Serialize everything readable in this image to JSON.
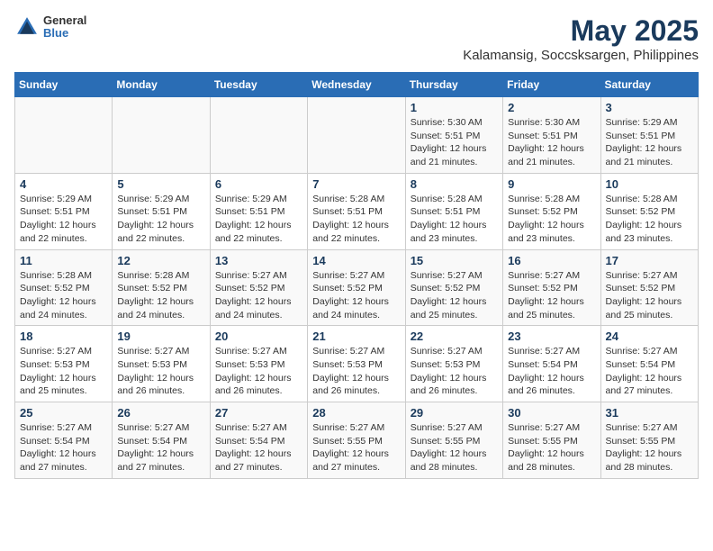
{
  "header": {
    "logo_line1": "General",
    "logo_line2": "Blue",
    "title": "May 2025",
    "subtitle": "Kalamansig, Soccsksargen, Philippines"
  },
  "weekdays": [
    "Sunday",
    "Monday",
    "Tuesday",
    "Wednesday",
    "Thursday",
    "Friday",
    "Saturday"
  ],
  "weeks": [
    [
      {
        "day": "",
        "info": ""
      },
      {
        "day": "",
        "info": ""
      },
      {
        "day": "",
        "info": ""
      },
      {
        "day": "",
        "info": ""
      },
      {
        "day": "1",
        "info": "Sunrise: 5:30 AM\nSunset: 5:51 PM\nDaylight: 12 hours\nand 21 minutes."
      },
      {
        "day": "2",
        "info": "Sunrise: 5:30 AM\nSunset: 5:51 PM\nDaylight: 12 hours\nand 21 minutes."
      },
      {
        "day": "3",
        "info": "Sunrise: 5:29 AM\nSunset: 5:51 PM\nDaylight: 12 hours\nand 21 minutes."
      }
    ],
    [
      {
        "day": "4",
        "info": "Sunrise: 5:29 AM\nSunset: 5:51 PM\nDaylight: 12 hours\nand 22 minutes."
      },
      {
        "day": "5",
        "info": "Sunrise: 5:29 AM\nSunset: 5:51 PM\nDaylight: 12 hours\nand 22 minutes."
      },
      {
        "day": "6",
        "info": "Sunrise: 5:29 AM\nSunset: 5:51 PM\nDaylight: 12 hours\nand 22 minutes."
      },
      {
        "day": "7",
        "info": "Sunrise: 5:28 AM\nSunset: 5:51 PM\nDaylight: 12 hours\nand 22 minutes."
      },
      {
        "day": "8",
        "info": "Sunrise: 5:28 AM\nSunset: 5:51 PM\nDaylight: 12 hours\nand 23 minutes."
      },
      {
        "day": "9",
        "info": "Sunrise: 5:28 AM\nSunset: 5:52 PM\nDaylight: 12 hours\nand 23 minutes."
      },
      {
        "day": "10",
        "info": "Sunrise: 5:28 AM\nSunset: 5:52 PM\nDaylight: 12 hours\nand 23 minutes."
      }
    ],
    [
      {
        "day": "11",
        "info": "Sunrise: 5:28 AM\nSunset: 5:52 PM\nDaylight: 12 hours\nand 24 minutes."
      },
      {
        "day": "12",
        "info": "Sunrise: 5:28 AM\nSunset: 5:52 PM\nDaylight: 12 hours\nand 24 minutes."
      },
      {
        "day": "13",
        "info": "Sunrise: 5:27 AM\nSunset: 5:52 PM\nDaylight: 12 hours\nand 24 minutes."
      },
      {
        "day": "14",
        "info": "Sunrise: 5:27 AM\nSunset: 5:52 PM\nDaylight: 12 hours\nand 24 minutes."
      },
      {
        "day": "15",
        "info": "Sunrise: 5:27 AM\nSunset: 5:52 PM\nDaylight: 12 hours\nand 25 minutes."
      },
      {
        "day": "16",
        "info": "Sunrise: 5:27 AM\nSunset: 5:52 PM\nDaylight: 12 hours\nand 25 minutes."
      },
      {
        "day": "17",
        "info": "Sunrise: 5:27 AM\nSunset: 5:52 PM\nDaylight: 12 hours\nand 25 minutes."
      }
    ],
    [
      {
        "day": "18",
        "info": "Sunrise: 5:27 AM\nSunset: 5:53 PM\nDaylight: 12 hours\nand 25 minutes."
      },
      {
        "day": "19",
        "info": "Sunrise: 5:27 AM\nSunset: 5:53 PM\nDaylight: 12 hours\nand 26 minutes."
      },
      {
        "day": "20",
        "info": "Sunrise: 5:27 AM\nSunset: 5:53 PM\nDaylight: 12 hours\nand 26 minutes."
      },
      {
        "day": "21",
        "info": "Sunrise: 5:27 AM\nSunset: 5:53 PM\nDaylight: 12 hours\nand 26 minutes."
      },
      {
        "day": "22",
        "info": "Sunrise: 5:27 AM\nSunset: 5:53 PM\nDaylight: 12 hours\nand 26 minutes."
      },
      {
        "day": "23",
        "info": "Sunrise: 5:27 AM\nSunset: 5:54 PM\nDaylight: 12 hours\nand 26 minutes."
      },
      {
        "day": "24",
        "info": "Sunrise: 5:27 AM\nSunset: 5:54 PM\nDaylight: 12 hours\nand 27 minutes."
      }
    ],
    [
      {
        "day": "25",
        "info": "Sunrise: 5:27 AM\nSunset: 5:54 PM\nDaylight: 12 hours\nand 27 minutes."
      },
      {
        "day": "26",
        "info": "Sunrise: 5:27 AM\nSunset: 5:54 PM\nDaylight: 12 hours\nand 27 minutes."
      },
      {
        "day": "27",
        "info": "Sunrise: 5:27 AM\nSunset: 5:54 PM\nDaylight: 12 hours\nand 27 minutes."
      },
      {
        "day": "28",
        "info": "Sunrise: 5:27 AM\nSunset: 5:55 PM\nDaylight: 12 hours\nand 27 minutes."
      },
      {
        "day": "29",
        "info": "Sunrise: 5:27 AM\nSunset: 5:55 PM\nDaylight: 12 hours\nand 28 minutes."
      },
      {
        "day": "30",
        "info": "Sunrise: 5:27 AM\nSunset: 5:55 PM\nDaylight: 12 hours\nand 28 minutes."
      },
      {
        "day": "31",
        "info": "Sunrise: 5:27 AM\nSunset: 5:55 PM\nDaylight: 12 hours\nand 28 minutes."
      }
    ]
  ]
}
